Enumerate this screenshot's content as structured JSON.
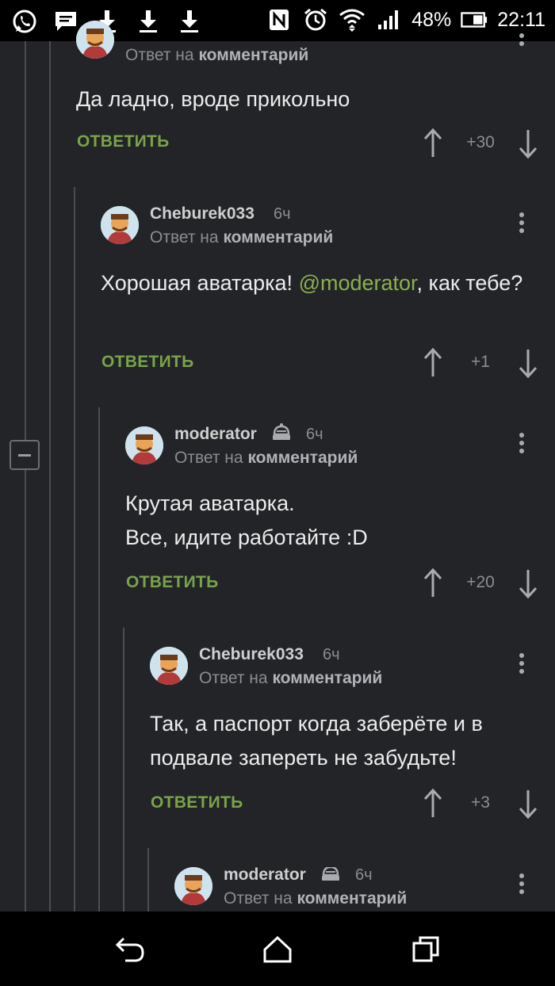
{
  "status_bar": {
    "battery_percent": "48%",
    "time": "22:11",
    "left_icons": [
      "whatsapp-icon",
      "message-icon",
      "download-icon",
      "download-icon",
      "download-icon"
    ],
    "right_icons": [
      "nfc-icon",
      "alarm-icon",
      "wifi-icon",
      "signal-icon",
      "battery-icon"
    ]
  },
  "colors": {
    "background": "#222428",
    "accent_green": "#79a34a",
    "mention": "#8ab04f"
  },
  "comments": [
    {
      "author": "",
      "time": "",
      "reply_prefix": "Ответ на",
      "reply_target": "комментарий",
      "text": "Да ладно, вроде прикольно",
      "reply_label": "ОТВЕТИТЬ",
      "score": "+30"
    },
    {
      "author": "Cheburek033",
      "time": "6ч",
      "reply_prefix": "Ответ на",
      "reply_target": "комментарий",
      "text_before": "Хорошая аватарка! ",
      "mention": "@moderator",
      "text_after": ", как тебе?",
      "reply_label": "ОТВЕТИТЬ",
      "score": "+1"
    },
    {
      "author": "moderator",
      "time": "6ч",
      "reply_prefix": "Ответ на",
      "reply_target": "комментарий",
      "text_line1": "Крутая аватарка.",
      "text_line2": "Все, идите работайте :D",
      "reply_label": "ОТВЕТИТЬ",
      "score": "+20"
    },
    {
      "author": "Cheburek033",
      "time": "6ч",
      "reply_prefix": "Ответ на",
      "reply_target": "комментарий",
      "text": "Так, а паспорт когда заберёте и в подвале запереть не забудьте!",
      "reply_label": "ОТВЕТИТЬ",
      "score": "+3"
    },
    {
      "author": "moderator",
      "time": "6ч",
      "reply_prefix": "Ответ на",
      "reply_target": "комментарий"
    }
  ],
  "nav_bar": {
    "icons": [
      "back-icon",
      "home-icon",
      "recents-icon"
    ]
  }
}
